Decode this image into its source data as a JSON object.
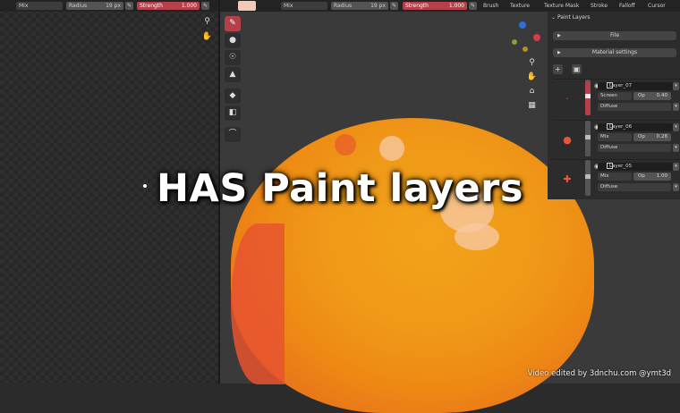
{
  "left_editor": {
    "header": {
      "blend": "Mix",
      "radius_label": "Radius",
      "radius_value": "19 px",
      "strength_label": "Strength",
      "strength_value": "1.000"
    },
    "nav_icons": [
      "zoom-icon",
      "hand-icon"
    ]
  },
  "viewport": {
    "header": {
      "blend": "Mix",
      "radius_label": "Radius",
      "radius_value": "19 px",
      "strength_label": "Strength",
      "strength_value": "1.000",
      "menus": [
        "Brush",
        "Texture",
        "Texture Mask",
        "Stroke",
        "Falloff",
        "Cursor"
      ]
    },
    "tools": [
      "brush-icon",
      "drop-icon",
      "smear-icon",
      "clone-icon",
      "fill-icon",
      "mask-icon",
      "annotate-icon"
    ]
  },
  "panel": {
    "title": "Paint Layers",
    "file_button": "File",
    "material_settings": "Material settings",
    "layers": [
      {
        "name": "Layer_07",
        "blend": "Screen",
        "op_label": "Op",
        "opacity": "0.40",
        "channel": "Diffuse",
        "thumb": "·",
        "fill": 0.95
      },
      {
        "name": "Layer_06",
        "blend": "Mix",
        "op_label": "Op",
        "opacity": "0.28",
        "channel": "Diffuse",
        "thumb": "●",
        "fill": 0.5
      },
      {
        "name": "Layer_05",
        "blend": "Mix",
        "op_label": "Op",
        "opacity": "1.00",
        "channel": "Diffuse",
        "thumb": "✚",
        "fill": 0.5
      }
    ]
  },
  "overlay": {
    "title": "HAS Paint layers",
    "credit": "Video edited by 3dnchu.com @ymt3d"
  },
  "colors": {
    "accent": "#b5404a",
    "orange": "#f09a18",
    "swatch": "#f2c9b5"
  }
}
